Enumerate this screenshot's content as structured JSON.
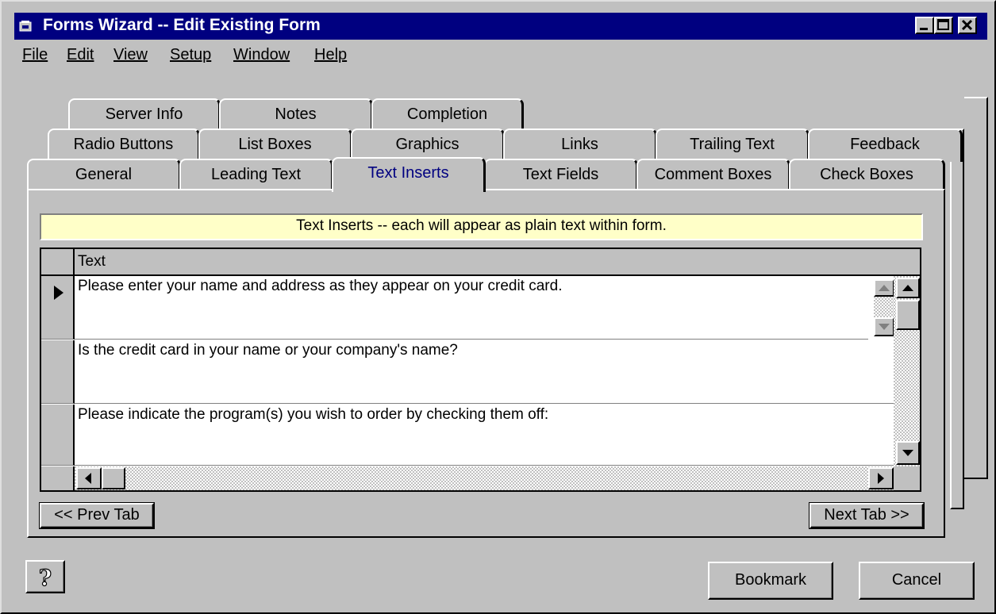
{
  "window": {
    "title": "Forms Wizard -- Edit Existing Form"
  },
  "menu": [
    "File",
    "Edit",
    "View",
    "Setup",
    "Window",
    "Help"
  ],
  "tabs": {
    "row1": [
      "Server Info",
      "Notes",
      "Completion"
    ],
    "row2": [
      "Radio Buttons",
      "List Boxes",
      "Graphics",
      "Links",
      "Trailing Text",
      "Feedback"
    ],
    "row3": [
      "General",
      "Leading Text",
      "Text Inserts",
      "Text Fields",
      "Comment Boxes",
      "Check Boxes"
    ],
    "active": "Text Inserts"
  },
  "banner": "Text Inserts -- each will appear as plain text within form.",
  "grid": {
    "column_header": "Text",
    "rows": [
      "Please enter your name and address as they appear on your credit card.",
      "Is the credit card in your name or your company's name?",
      "Please indicate the program(s) you wish to order by checking them off:"
    ]
  },
  "nav": {
    "prev": "<< Prev Tab",
    "next": "Next Tab >>"
  },
  "buttons": {
    "help": "?",
    "bookmark": "Bookmark",
    "cancel": "Cancel"
  },
  "colors": {
    "titlebar": "#000080",
    "face": "#c0c0c0",
    "active_tab_text": "#000080",
    "banner": "#ffffc8"
  }
}
